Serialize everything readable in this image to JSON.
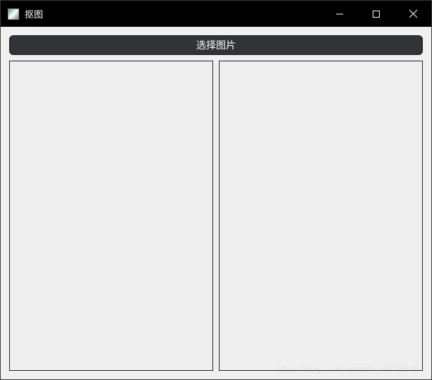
{
  "window": {
    "title": "抠图"
  },
  "toolbar": {
    "select_image_label": "选择图片"
  },
  "watermark": {
    "text": "https://blog.csdn.net/m0_46778548"
  }
}
